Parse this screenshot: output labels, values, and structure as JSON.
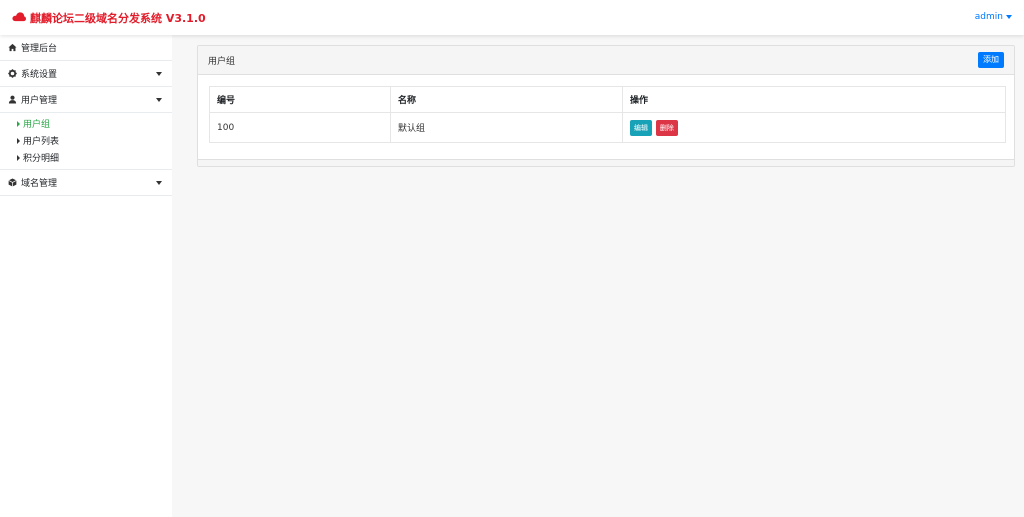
{
  "header": {
    "title": "麒麟论坛二级域名分发系统 V3.1.0",
    "logo_icon": "cloud-icon",
    "brand_color": "#e21c2a",
    "user": "admin"
  },
  "sidebar": {
    "items": [
      {
        "label": "管理后台",
        "icon": "home-icon"
      },
      {
        "label": "系统设置",
        "icon": "gear-icon"
      },
      {
        "label": "用户管理",
        "icon": "user-icon"
      },
      {
        "label": "域名管理",
        "icon": "cube-icon"
      }
    ],
    "user_sub": [
      {
        "label": "用户组",
        "active": true
      },
      {
        "label": "用户列表"
      },
      {
        "label": "积分明细"
      }
    ]
  },
  "main": {
    "card_title": "用户组",
    "add_label": "添加",
    "table": {
      "headers": [
        "编号",
        "名称",
        "操作"
      ],
      "rows": [
        {
          "id": "100",
          "name": "默认组",
          "edit": "编辑",
          "delete": "删除"
        }
      ]
    }
  }
}
